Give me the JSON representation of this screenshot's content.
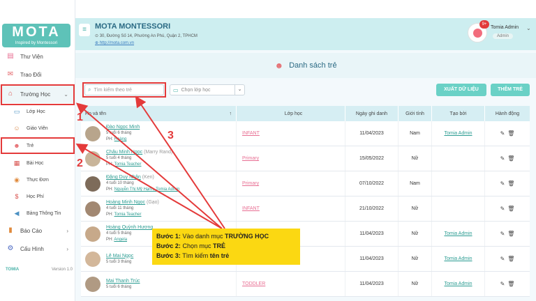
{
  "brand": {
    "logo_text": "MOTA",
    "tagline": "Inspired by Montessori",
    "footer_brand": "TOMIA",
    "version": "Version 1.0"
  },
  "sidebar": {
    "items": [
      {
        "label": "Thư Viện",
        "icon": "book-icon"
      },
      {
        "label": "Trao Đổi",
        "icon": "chat-icon"
      },
      {
        "label": "Trường Học",
        "icon": "school-icon"
      },
      {
        "label": "Báo Cáo",
        "icon": "chart-icon"
      },
      {
        "label": "Cấu Hình",
        "icon": "gear-icon"
      }
    ],
    "sub_items": [
      {
        "label": "Lớp Học"
      },
      {
        "label": "Giáo Viên"
      },
      {
        "label": "Trẻ"
      },
      {
        "label": "Bài Học"
      },
      {
        "label": "Thực Đơn"
      },
      {
        "label": "Học Phí"
      },
      {
        "label": "Bảng Thông Tin"
      }
    ]
  },
  "header": {
    "org_name": "MOTA MONTESSORI",
    "address": "30, Đường Số 14, Phường An Phú, Quận 2, TPHCM",
    "website": "http://mota.com.vn",
    "notification_count": "9+",
    "user_name": "Tomia Admin",
    "user_role": "Admin"
  },
  "page": {
    "title": "Danh sách trẻ",
    "search_placeholder": "Tìm kiếm theo trẻ",
    "class_placeholder": "Chọn lớp học",
    "export_label": "XUẤT DỮ LIỆU",
    "add_label": "THÊM TRẺ"
  },
  "table": {
    "headers": {
      "name": "Họ và tên",
      "class": "Lớp học",
      "date": "Ngày ghi danh",
      "gender": "Giới tính",
      "creator": "Tạo bởi",
      "action": "Hành động"
    },
    "rows": [
      {
        "name": "Đào Ngọc Minh",
        "nick": "",
        "age": "5 tuổi 6 tháng",
        "ph": "Hoàng",
        "class": "INFANT",
        "date": "11/04/2023",
        "gender": "Nam",
        "creator": "Tomia Admin"
      },
      {
        "name": "Châu Minh Ngọc",
        "nick": "(Marry Rand)",
        "age": "5 tuổi 4 tháng",
        "ph": "Tomia Teacher",
        "class": "Primary",
        "date": "15/05/2022",
        "gender": "Nữ",
        "creator": ""
      },
      {
        "name": "Đặng Duy Nhân",
        "nick": "(Ken)",
        "age": "4 tuổi 10 tháng",
        "ph": "Nguyễn Thị Mỹ Hạnh, Tomia Admin",
        "class": "Primary",
        "date": "07/10/2022",
        "gender": "Nam",
        "creator": ""
      },
      {
        "name": "Hoàng Minh Ngọc",
        "nick": "(Gạo)",
        "age": "4 tuổi 11 tháng",
        "ph": "Tomia Teacher",
        "class": "INFANT",
        "date": "21/10/2022",
        "gender": "Nữ",
        "creator": ""
      },
      {
        "name": "Hoàng Quỳnh Hương",
        "nick": "",
        "age": "4 tuổi 5 tháng",
        "ph": "Angela",
        "class": "",
        "date": "11/04/2023",
        "gender": "Nữ",
        "creator": "Tomia Admin"
      },
      {
        "name": "Lê Mai Ngọc",
        "nick": "",
        "age": "5 tuổi 3 tháng",
        "ph": "",
        "class": "",
        "date": "11/04/2023",
        "gender": "Nữ",
        "creator": "Tomia Admin"
      },
      {
        "name": "Mai Thanh Trúc",
        "nick": "",
        "age": "5 tuổi 6 tháng",
        "ph": "",
        "class": "TODDLER",
        "date": "11/04/2023",
        "gender": "Nữ",
        "creator": "Tomia Admin"
      }
    ]
  },
  "annotation": {
    "step_numbers": [
      "1",
      "2",
      "3"
    ],
    "step1_prefix": "Bước 1:",
    "step1_text": "Vào danh mục",
    "step1_bold": "TRƯỜNG HỌC",
    "step2_prefix": "Bước 2:",
    "step2_text": "Chọn mục",
    "step2_bold": "TRẺ",
    "step3_prefix": "Bước 3:",
    "step3_text": "Tìm kiếm",
    "step3_bold": "tên trẻ"
  },
  "colors": {
    "accent": "#4bb3a9",
    "annotation_red": "#e43a3a",
    "note_yellow": "#fbd812"
  }
}
